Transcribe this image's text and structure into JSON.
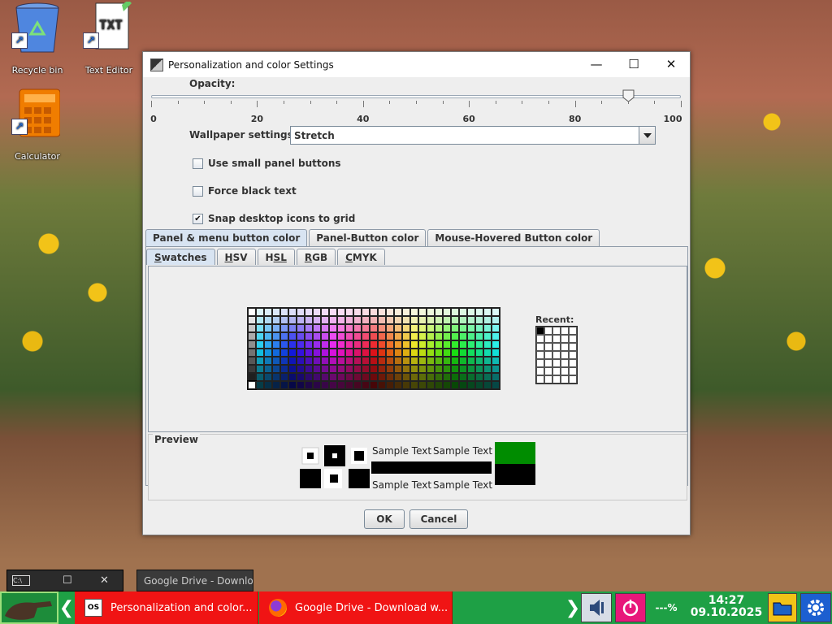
{
  "desktop": {
    "icons": [
      {
        "label": "Recycle bin"
      },
      {
        "label": "Text Editor"
      },
      {
        "label": "Calculator"
      }
    ]
  },
  "dialog": {
    "title": "Personalization and color Settings",
    "opacity": {
      "label": "Opacity:",
      "value_percent": 90,
      "ticks": [
        "0",
        "20",
        "40",
        "60",
        "80",
        "100"
      ]
    },
    "wallpaper": {
      "label": "Wallpaper settings :",
      "value": "Stretch"
    },
    "checkboxes": [
      {
        "label": "Use small panel buttons",
        "checked": false
      },
      {
        "label": "Force black text",
        "checked": false
      },
      {
        "label": "Snap desktop icons to grid",
        "checked": true
      }
    ],
    "tabs": [
      "Panel & menu button color",
      "Panel-Button color",
      "Mouse-Hovered Button color"
    ],
    "subtabs": [
      {
        "mnemonic": "S",
        "rest": "watches"
      },
      {
        "mnemonic": "H",
        "rest": "SV"
      },
      {
        "mnemonic": "H",
        "rest": "SL"
      },
      {
        "mnemonic": "R",
        "rest": "GB"
      },
      {
        "mnemonic": "C",
        "rest": "MYK"
      }
    ],
    "recent_label": "Recent:",
    "preview": {
      "label": "Preview",
      "sample_text": "Sample Text",
      "preview_color": "#008c00"
    },
    "ok_label": "OK",
    "cancel_label": "Cancel"
  },
  "mini_window": {
    "close": "✕",
    "maximize": "☐"
  },
  "tooltip": "Google Drive - Downloa...",
  "taskbar": {
    "items": [
      {
        "label": "Personalization and color..."
      },
      {
        "label": "Google Drive - Download w..."
      }
    ],
    "battery": "---%",
    "time": "14:27",
    "date": "09.10.2025"
  },
  "colors": {
    "taskbar": "#1ea045",
    "task_item": "#f01414",
    "accent_tab": "#d8e4f2"
  }
}
